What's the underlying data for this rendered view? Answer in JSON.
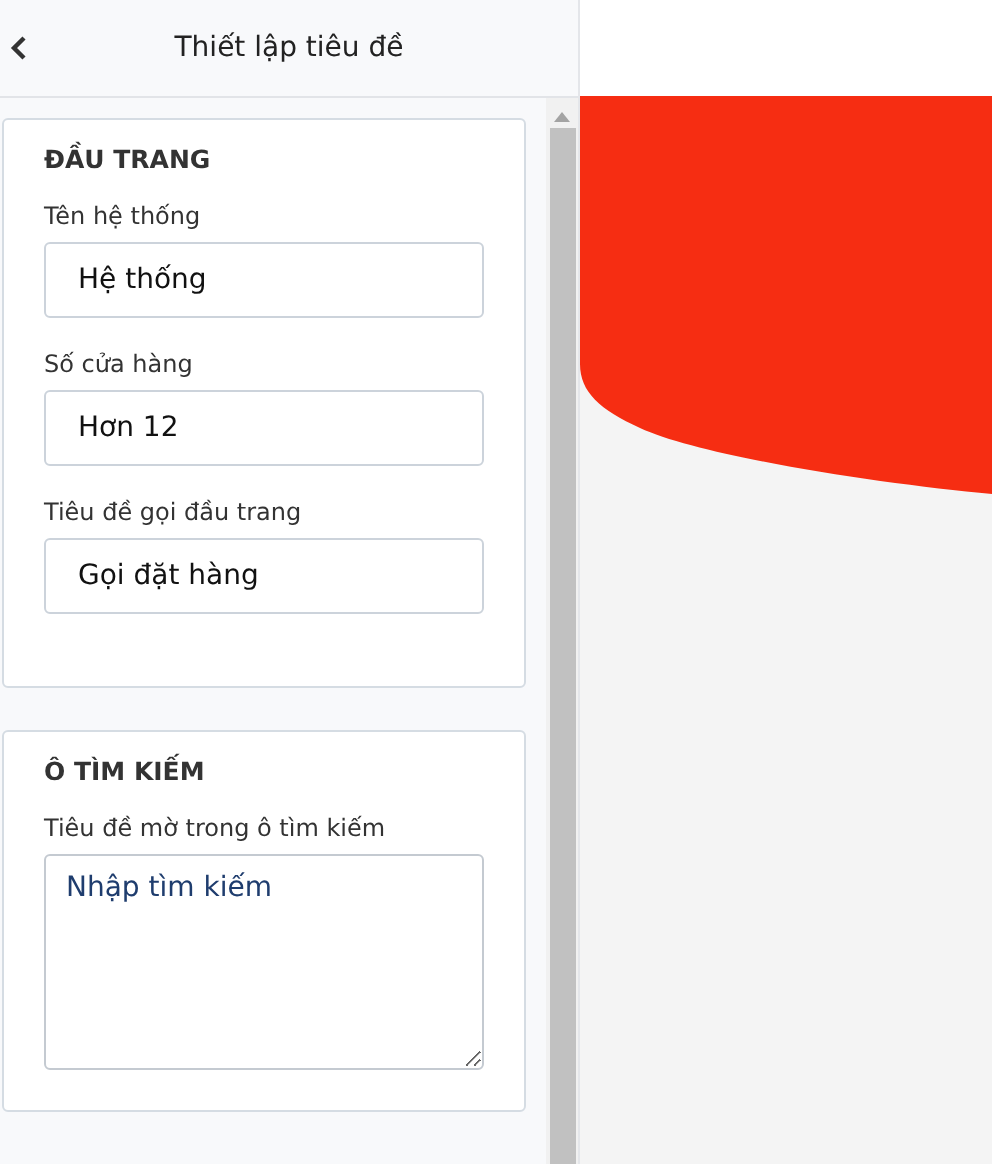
{
  "header": {
    "title": "Thiết lập tiêu đề"
  },
  "sections": [
    {
      "title": "ĐẦU TRANG",
      "fields": [
        {
          "kind": "input",
          "label": "Tên hệ thống",
          "value": "Hệ thống"
        },
        {
          "kind": "input",
          "label": "Số cửa hàng",
          "value": "Hơn 12"
        },
        {
          "kind": "input",
          "label": "Tiêu đề gọi đầu trang",
          "value": "Gọi đặt hàng"
        }
      ]
    },
    {
      "title": "Ô TÌM KIẾM",
      "fields": [
        {
          "kind": "textarea",
          "label": "Tiêu đề mờ trong ô tìm kiếm",
          "value": "Nhập tìm kiếm"
        }
      ]
    }
  ]
}
